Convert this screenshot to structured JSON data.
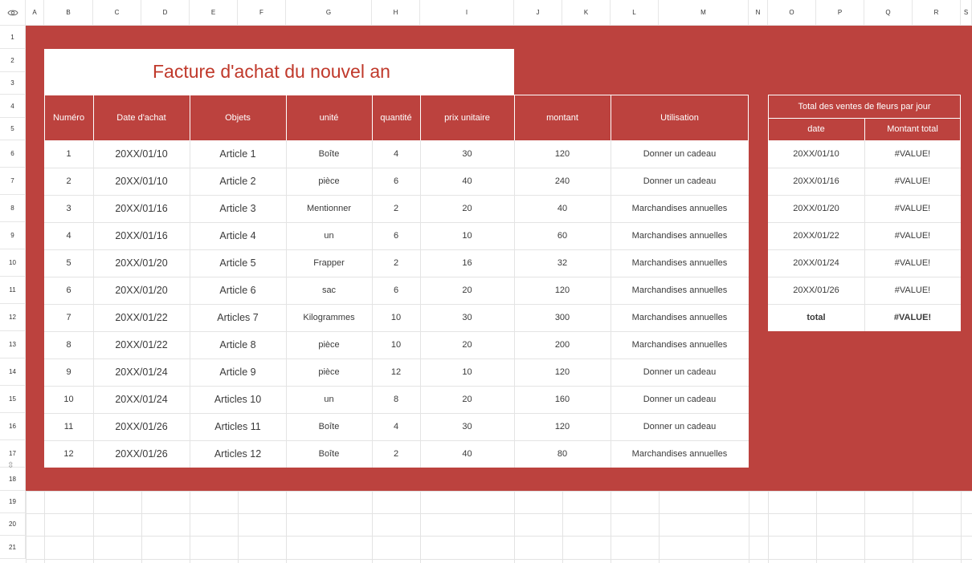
{
  "columns": [
    "A",
    "B",
    "C",
    "D",
    "E",
    "F",
    "G",
    "H",
    "I",
    "J",
    "K",
    "L",
    "M",
    "N",
    "O",
    "P",
    "Q",
    "R",
    "S"
  ],
  "rows": [
    "1",
    "2",
    "3",
    "4",
    "5",
    "6",
    "7",
    "8",
    "9",
    "10",
    "11",
    "12",
    "13",
    "14",
    "15",
    "16",
    "17",
    "18",
    "19",
    "20",
    "21"
  ],
  "invoice": {
    "title": "Facture d'achat du nouvel an",
    "headers": {
      "numero": "Numéro",
      "date": "Date d'achat",
      "objets": "Objets",
      "unite": "unité",
      "quantite": "quantité",
      "prix": "prix unitaire",
      "montant": "montant",
      "utilisation": "Utilisation"
    },
    "rows": [
      [
        "1",
        "20XX/01/10",
        "Article 1",
        "Boîte",
        "4",
        "30",
        "120",
        "Donner un cadeau"
      ],
      [
        "2",
        "20XX/01/10",
        "Article 2",
        "pièce",
        "6",
        "40",
        "240",
        "Donner un cadeau"
      ],
      [
        "3",
        "20XX/01/16",
        "Article 3",
        "Mentionner",
        "2",
        "20",
        "40",
        "Marchandises annuelles"
      ],
      [
        "4",
        "20XX/01/16",
        "Article 4",
        "un",
        "6",
        "10",
        "60",
        "Marchandises annuelles"
      ],
      [
        "5",
        "20XX/01/20",
        "Article 5",
        "Frapper",
        "2",
        "16",
        "32",
        "Marchandises annuelles"
      ],
      [
        "6",
        "20XX/01/20",
        "Article 6",
        "sac",
        "6",
        "20",
        "120",
        "Marchandises annuelles"
      ],
      [
        "7",
        "20XX/01/22",
        "Articles 7",
        "Kilogrammes",
        "10",
        "30",
        "300",
        "Marchandises annuelles"
      ],
      [
        "8",
        "20XX/01/22",
        "Article 8",
        "pièce",
        "10",
        "20",
        "200",
        "Marchandises annuelles"
      ],
      [
        "9",
        "20XX/01/24",
        "Article 9",
        "pièce",
        "12",
        "10",
        "120",
        "Donner un cadeau"
      ],
      [
        "10",
        "20XX/01/24",
        "Articles 10",
        "un",
        "8",
        "20",
        "160",
        "Donner un cadeau"
      ],
      [
        "11",
        "20XX/01/26",
        "Articles 11",
        "Boîte",
        "4",
        "30",
        "120",
        "Donner un cadeau"
      ],
      [
        "12",
        "20XX/01/26",
        "Articles 12",
        "Boîte",
        "2",
        "40",
        "80",
        "Marchandises annuelles"
      ]
    ]
  },
  "summary": {
    "title": "Total des ventes de fleurs par jour",
    "headers": {
      "date": "date",
      "montant": "Montant total"
    },
    "rows": [
      [
        "20XX/01/10",
        "#VALUE!"
      ],
      [
        "20XX/01/16",
        "#VALUE!"
      ],
      [
        "20XX/01/20",
        "#VALUE!"
      ],
      [
        "20XX/01/22",
        "#VALUE!"
      ],
      [
        "20XX/01/24",
        "#VALUE!"
      ],
      [
        "20XX/01/26",
        "#VALUE!"
      ]
    ],
    "total_label": "total",
    "total_value": "#VALUE!"
  },
  "colors": {
    "accent": "#bc423e",
    "title_text": "#c0392b"
  },
  "icons": {
    "corner": "eye-icon",
    "row_resize": "row-resize-icon"
  }
}
